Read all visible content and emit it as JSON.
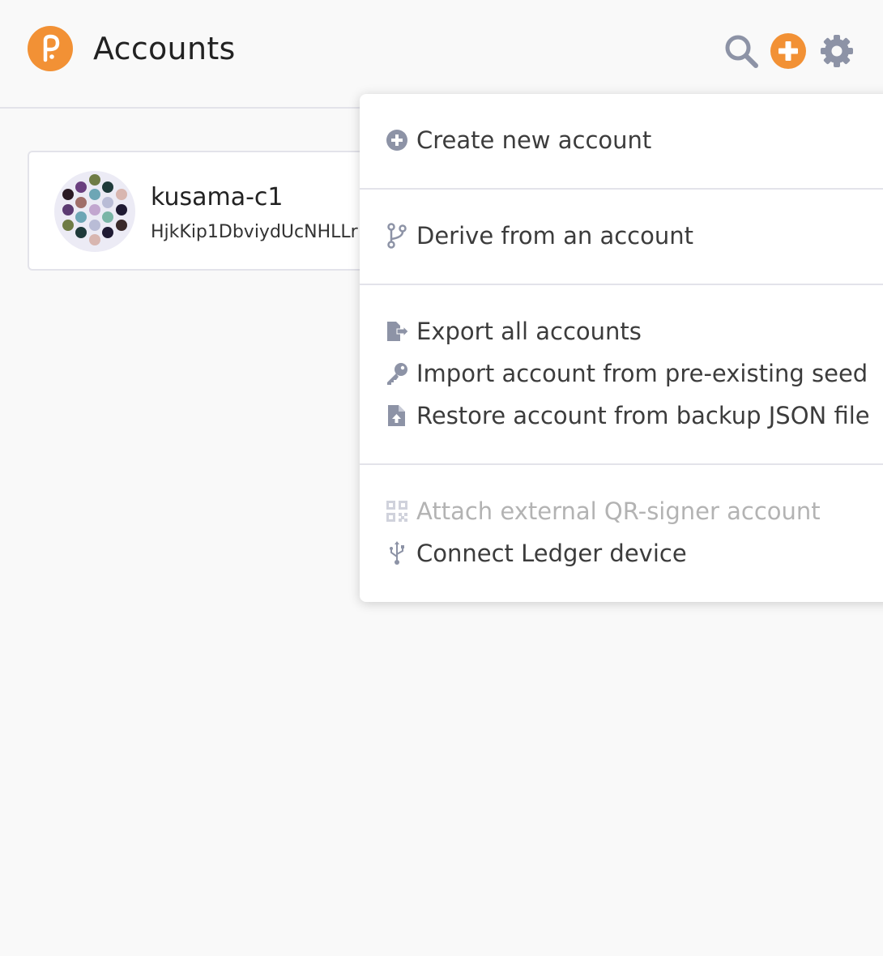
{
  "header": {
    "title": "Accounts",
    "logo_icon": "polkadot-logo-icon",
    "actions": [
      {
        "name": "search",
        "icon": "search-icon"
      },
      {
        "name": "add",
        "icon": "plus-circle-icon"
      },
      {
        "name": "settings",
        "icon": "gear-icon"
      }
    ]
  },
  "account": {
    "name": "kusama-c1",
    "address": "HjkKip1DbviydUcNHLLr"
  },
  "menu": {
    "sections": [
      {
        "items": [
          {
            "label": "Create new account",
            "icon": "plus-circle-icon"
          }
        ]
      },
      {
        "items": [
          {
            "label": "Derive from an account",
            "icon": "code-branch-icon"
          }
        ]
      },
      {
        "items": [
          {
            "label": "Export all accounts",
            "icon": "file-export-icon"
          },
          {
            "label": "Import account from pre-existing seed",
            "icon": "key-icon"
          },
          {
            "label": "Restore account from backup JSON file",
            "icon": "file-upload-icon"
          }
        ]
      },
      {
        "items": [
          {
            "label": "Attach external QR-signer account",
            "icon": "qrcode-icon",
            "disabled": true
          },
          {
            "label": "Connect Ledger device",
            "icon": "usb-icon"
          }
        ]
      }
    ]
  },
  "colors": {
    "accent": "#f29135",
    "icon_gray": "#8d93a6",
    "divider": "#e3e3ea",
    "background": "#f9f9f9"
  }
}
